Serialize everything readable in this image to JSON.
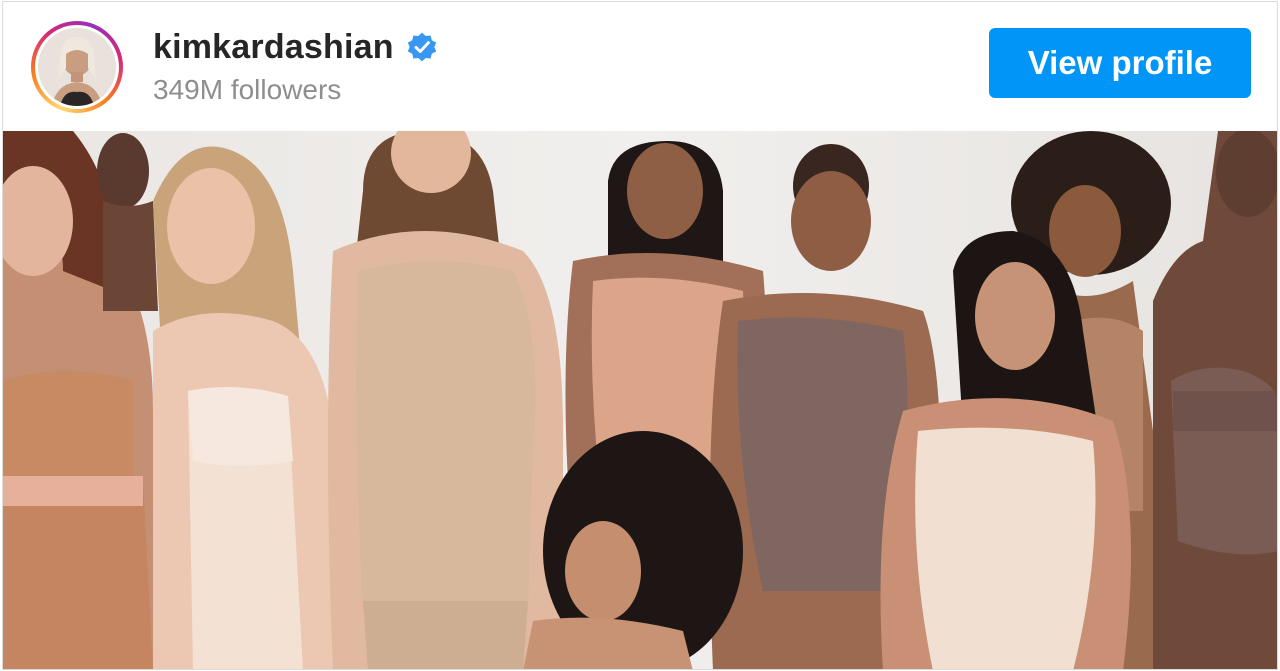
{
  "account": {
    "username": "kimkardashian",
    "followers_text": "349M followers",
    "verified": true
  },
  "actions": {
    "view_profile_label": "View profile"
  },
  "colors": {
    "button_bg": "#0095f6",
    "verified_badge": "#3897f0",
    "username_text": "#262626",
    "secondary_text": "#8e8e8e"
  },
  "icons": {
    "verified": "verified-badge-icon"
  }
}
